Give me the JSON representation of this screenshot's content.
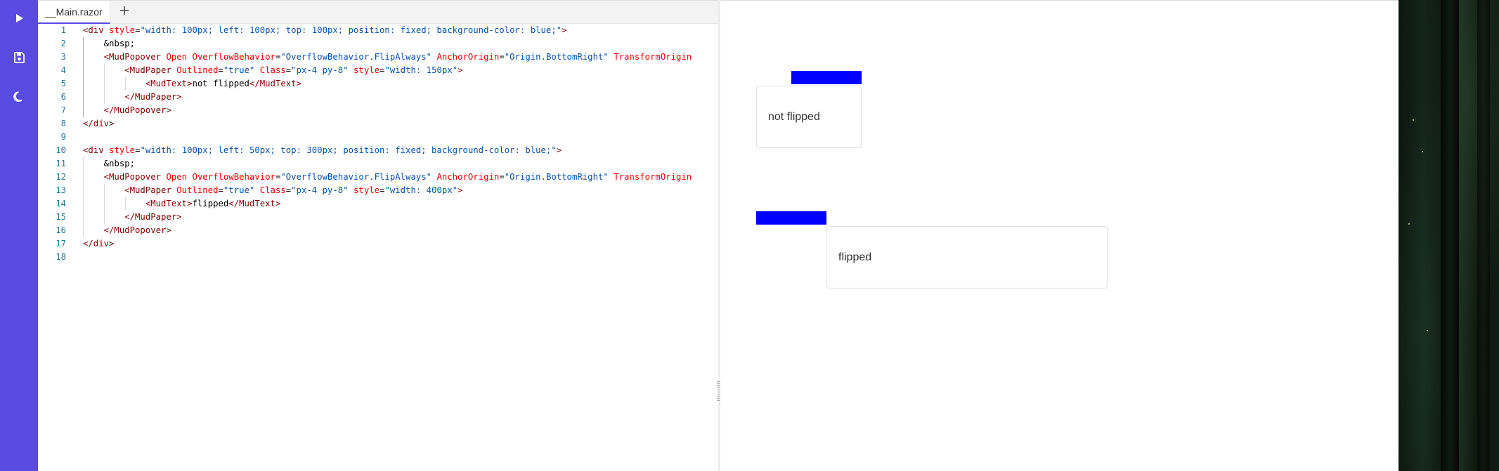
{
  "sidebar": {
    "icons": [
      "play-icon",
      "save-icon",
      "moon-icon"
    ],
    "accent": "#594ae2"
  },
  "editor": {
    "tab_label": "__Main.razor",
    "add_tab_icon": "plus-icon",
    "lines": [
      [
        {
          "c": "tag",
          "t": "<div "
        },
        {
          "c": "attr",
          "t": "style"
        },
        {
          "c": "text",
          "t": "="
        },
        {
          "c": "val",
          "t": "\"width: 100px; left: 100px; top: 100px; position: fixed; background-color: blue;\""
        },
        {
          "c": "tag",
          "t": ">"
        }
      ],
      [
        {
          "c": "text",
          "t": "    &nbsp;"
        }
      ],
      [
        {
          "c": "tag",
          "t": "    <MudPopover "
        },
        {
          "c": "attr",
          "t": "Open OverflowBehavior"
        },
        {
          "c": "text",
          "t": "="
        },
        {
          "c": "val",
          "t": "\"OverflowBehavior.FlipAlways\""
        },
        {
          "c": "text",
          "t": " "
        },
        {
          "c": "attr",
          "t": "AnchorOrigin"
        },
        {
          "c": "text",
          "t": "="
        },
        {
          "c": "val",
          "t": "\"Origin.BottomRight\""
        },
        {
          "c": "text",
          "t": " "
        },
        {
          "c": "attr",
          "t": "TransformOrigin"
        }
      ],
      [
        {
          "c": "tag",
          "t": "        <MudPaper "
        },
        {
          "c": "attr",
          "t": "Outlined"
        },
        {
          "c": "text",
          "t": "="
        },
        {
          "c": "val",
          "t": "\"true\""
        },
        {
          "c": "text",
          "t": " "
        },
        {
          "c": "attr",
          "t": "Class"
        },
        {
          "c": "text",
          "t": "="
        },
        {
          "c": "val",
          "t": "\"px-4 py-8\""
        },
        {
          "c": "text",
          "t": " "
        },
        {
          "c": "attr",
          "t": "style"
        },
        {
          "c": "text",
          "t": "="
        },
        {
          "c": "val",
          "t": "\"width: 150px\""
        },
        {
          "c": "tag",
          "t": ">"
        }
      ],
      [
        {
          "c": "tag",
          "t": "            <MudText>"
        },
        {
          "c": "text",
          "t": "not flipped"
        },
        {
          "c": "tag",
          "t": "</MudText>"
        }
      ],
      [
        {
          "c": "tag",
          "t": "        </MudPaper>"
        }
      ],
      [
        {
          "c": "tag",
          "t": "    </MudPopover>"
        }
      ],
      [
        {
          "c": "tag",
          "t": "</div>"
        }
      ],
      [],
      [
        {
          "c": "tag",
          "t": "<div "
        },
        {
          "c": "attr",
          "t": "style"
        },
        {
          "c": "text",
          "t": "="
        },
        {
          "c": "val",
          "t": "\"width: 100px; left: 50px; top: 300px; position: fixed; background-color: blue;\""
        },
        {
          "c": "tag",
          "t": ">"
        }
      ],
      [
        {
          "c": "text",
          "t": "    &nbsp;"
        }
      ],
      [
        {
          "c": "tag",
          "t": "    <MudPopover "
        },
        {
          "c": "attr",
          "t": "Open OverflowBehavior"
        },
        {
          "c": "text",
          "t": "="
        },
        {
          "c": "val",
          "t": "\"OverflowBehavior.FlipAlways\""
        },
        {
          "c": "text",
          "t": " "
        },
        {
          "c": "attr",
          "t": "AnchorOrigin"
        },
        {
          "c": "text",
          "t": "="
        },
        {
          "c": "val",
          "t": "\"Origin.BottomRight\""
        },
        {
          "c": "text",
          "t": " "
        },
        {
          "c": "attr",
          "t": "TransformOrigin"
        }
      ],
      [
        {
          "c": "tag",
          "t": "        <MudPaper "
        },
        {
          "c": "attr",
          "t": "Outlined"
        },
        {
          "c": "text",
          "t": "="
        },
        {
          "c": "val",
          "t": "\"true\""
        },
        {
          "c": "text",
          "t": " "
        },
        {
          "c": "attr",
          "t": "Class"
        },
        {
          "c": "text",
          "t": "="
        },
        {
          "c": "val",
          "t": "\"px-4 py-8\""
        },
        {
          "c": "text",
          "t": " "
        },
        {
          "c": "attr",
          "t": "style"
        },
        {
          "c": "text",
          "t": "="
        },
        {
          "c": "val",
          "t": "\"width: 400px\""
        },
        {
          "c": "tag",
          "t": ">"
        }
      ],
      [
        {
          "c": "tag",
          "t": "            <MudText>"
        },
        {
          "c": "text",
          "t": "flipped"
        },
        {
          "c": "tag",
          "t": "</MudText>"
        }
      ],
      [
        {
          "c": "tag",
          "t": "        </MudPaper>"
        }
      ],
      [
        {
          "c": "tag",
          "t": "    </MudPopover>"
        }
      ],
      [
        {
          "c": "tag",
          "t": "</div>"
        }
      ],
      []
    ]
  },
  "preview": {
    "popover1_text": "not flipped",
    "popover2_text": "flipped",
    "anchor_color": "#0000ff"
  }
}
